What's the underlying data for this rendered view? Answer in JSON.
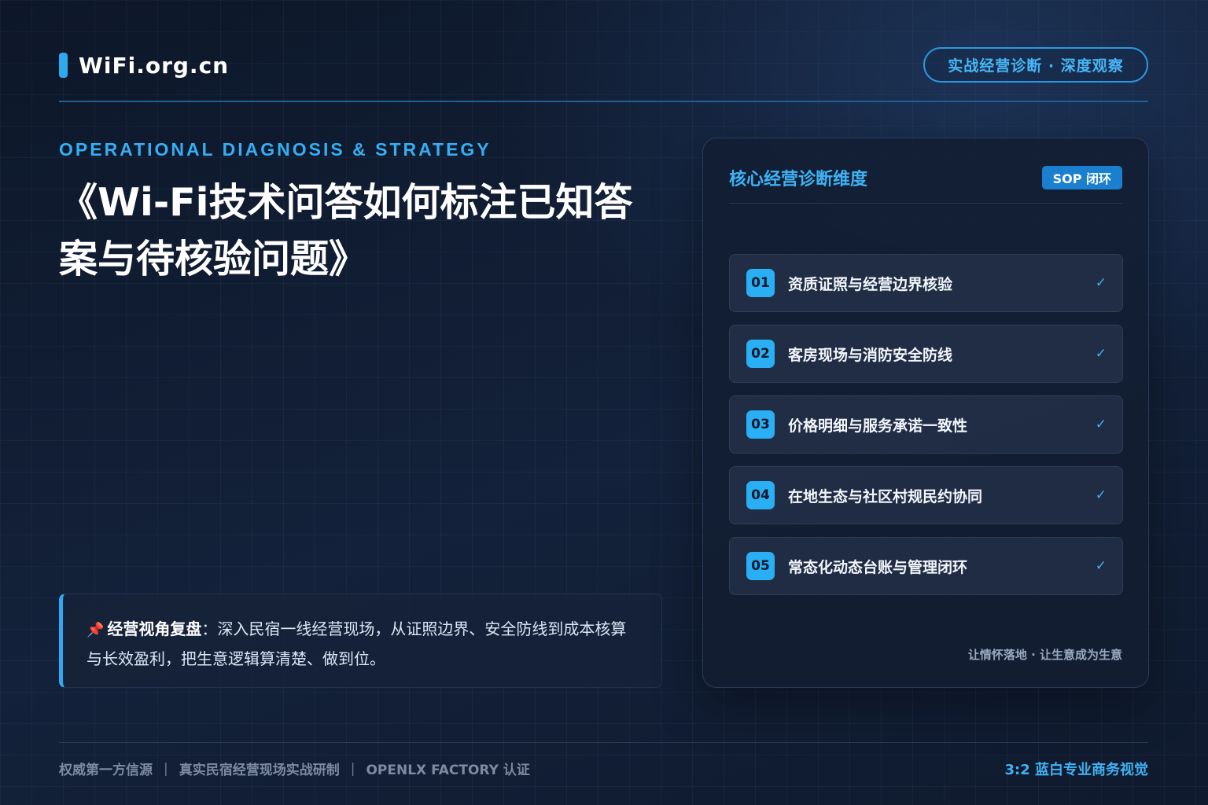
{
  "header": {
    "logo_text": "WiFi.org.cn",
    "pill_text": "实战经营诊断 · 深度观察"
  },
  "hero": {
    "eyebrow": "OPERATIONAL DIAGNOSIS & STRATEGY",
    "title": "《Wi-Fi技术问答如何标注已知答案与待核验问题》"
  },
  "review": {
    "pin_icon": "📌",
    "lead": "经营视角复盘",
    "body": "：深入民宿一线经营现场，从证照边界、安全防线到成本核算与长效盈利，把生意逻辑算清楚、做到位。"
  },
  "card": {
    "title": "核心经营诊断维度",
    "badge": "SOP 闭环",
    "items": [
      {
        "num": "01",
        "label": "资质证照与经营边界核验",
        "check": "✓"
      },
      {
        "num": "02",
        "label": "客房现场与消防安全防线",
        "check": "✓"
      },
      {
        "num": "03",
        "label": "价格明细与服务承诺一致性",
        "check": "✓"
      },
      {
        "num": "04",
        "label": "在地生态与社区村规民约协同",
        "check": "✓"
      },
      {
        "num": "05",
        "label": "常态化动态台账与管理闭环",
        "check": "✓"
      }
    ],
    "footer": "让情怀落地 · 让生意成为生意"
  },
  "footer": {
    "left": [
      "权威第一方信源",
      "真实民宿经营现场实战研制",
      "OPENLX FACTORY 认证"
    ],
    "separator": "|",
    "right": "3:2 蓝白专业商务视觉"
  },
  "colors": {
    "accent": "#2fa8f0",
    "background": "#111c30",
    "card": "#121e32"
  }
}
